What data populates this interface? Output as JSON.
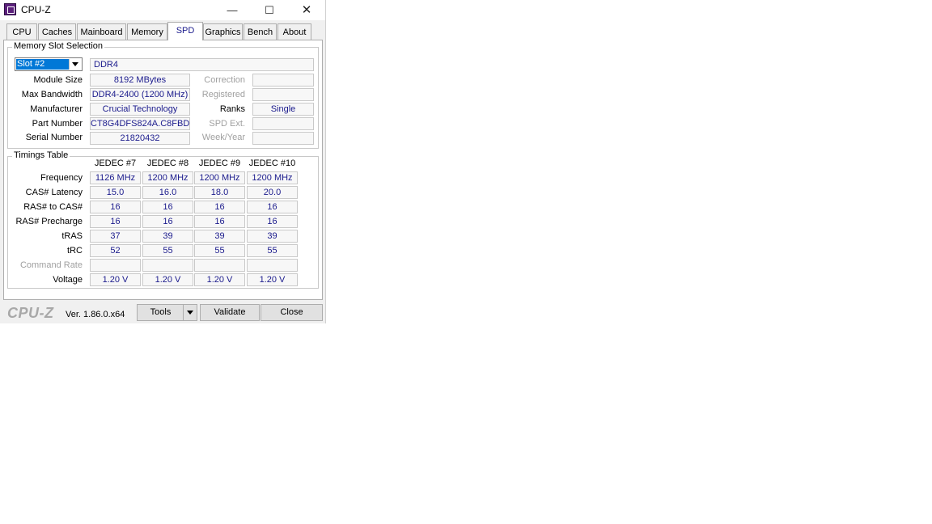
{
  "window": {
    "title": "CPU-Z",
    "minimize": "—",
    "maximize": "☐",
    "close": "✕"
  },
  "tabs": [
    {
      "label": "CPU"
    },
    {
      "label": "Caches"
    },
    {
      "label": "Mainboard"
    },
    {
      "label": "Memory"
    },
    {
      "label": "SPD"
    },
    {
      "label": "Graphics"
    },
    {
      "label": "Bench"
    },
    {
      "label": "About"
    }
  ],
  "active_tab": "SPD",
  "slot_section": {
    "title": "Memory Slot Selection",
    "slot_selected": "Slot #2",
    "type": "DDR4",
    "module_size": {
      "label": "Module Size",
      "value": "8192 MBytes"
    },
    "max_bandwidth": {
      "label": "Max Bandwidth",
      "value": "DDR4-2400 (1200 MHz)"
    },
    "manufacturer": {
      "label": "Manufacturer",
      "value": "Crucial Technology"
    },
    "part_number": {
      "label": "Part Number",
      "value": "CT8G4DFS824A.C8FBD"
    },
    "serial_number": {
      "label": "Serial Number",
      "value": "21820432"
    },
    "correction": {
      "label": "Correction",
      "value": ""
    },
    "registered": {
      "label": "Registered",
      "value": ""
    },
    "ranks": {
      "label": "Ranks",
      "value": "Single"
    },
    "spd_ext": {
      "label": "SPD Ext.",
      "value": ""
    },
    "week_year": {
      "label": "Week/Year",
      "value": ""
    }
  },
  "timings": {
    "title": "Timings Table",
    "columns": [
      "JEDEC #7",
      "JEDEC #8",
      "JEDEC #9",
      "JEDEC #10"
    ],
    "rows": [
      {
        "label": "Frequency",
        "values": [
          "1126 MHz",
          "1200 MHz",
          "1200 MHz",
          "1200 MHz"
        ]
      },
      {
        "label": "CAS# Latency",
        "values": [
          "15.0",
          "16.0",
          "18.0",
          "20.0"
        ]
      },
      {
        "label": "RAS# to CAS#",
        "values": [
          "16",
          "16",
          "16",
          "16"
        ]
      },
      {
        "label": "RAS# Precharge",
        "values": [
          "16",
          "16",
          "16",
          "16"
        ]
      },
      {
        "label": "tRAS",
        "values": [
          "37",
          "39",
          "39",
          "39"
        ]
      },
      {
        "label": "tRC",
        "values": [
          "52",
          "55",
          "55",
          "55"
        ]
      },
      {
        "label": "Command Rate",
        "values": [
          "",
          "",
          "",
          ""
        ]
      },
      {
        "label": "Voltage",
        "values": [
          "1.20 V",
          "1.20 V",
          "1.20 V",
          "1.20 V"
        ]
      }
    ]
  },
  "footer": {
    "logo": "CPU-Z",
    "version": "Ver. 1.86.0.x64",
    "tools": "Tools",
    "validate": "Validate",
    "close": "Close"
  }
}
